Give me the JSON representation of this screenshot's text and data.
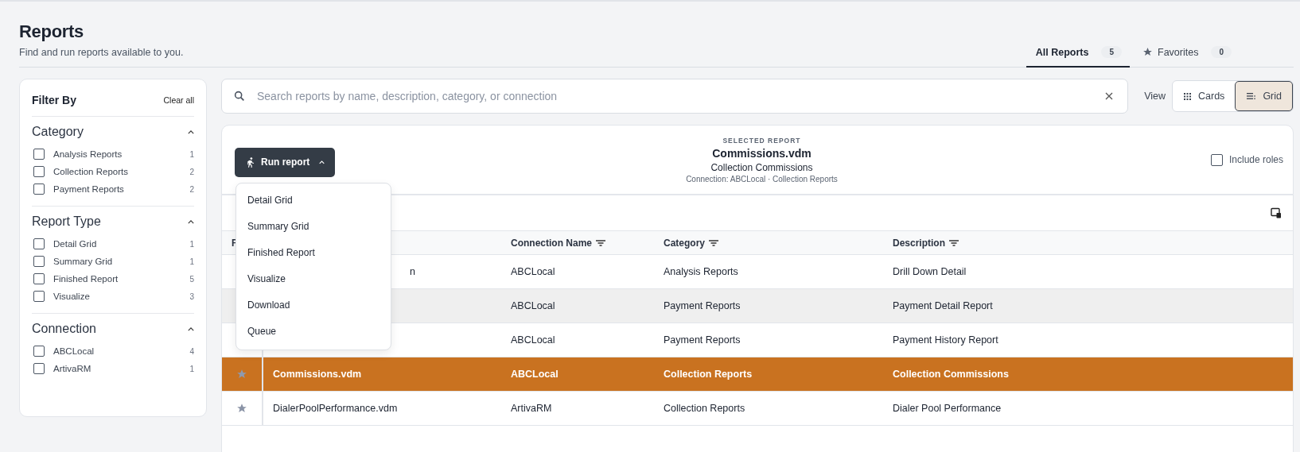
{
  "header": {
    "title": "Reports",
    "subtitle": "Find and run reports available to you."
  },
  "tabs": [
    {
      "label": "All Reports",
      "count": "5",
      "kind": "plain",
      "selected": true
    },
    {
      "label": "Favorites",
      "count": "0",
      "kind": "starred",
      "selected": false
    }
  ],
  "filter": {
    "title": "Filter By",
    "clear": "Clear all",
    "groups": [
      {
        "title": "Category",
        "expanded": true,
        "options": [
          {
            "label": "Analysis Reports",
            "count": "1",
            "checked": false
          },
          {
            "label": "Collection Reports",
            "count": "2",
            "checked": false
          },
          {
            "label": "Payment Reports",
            "count": "2",
            "checked": false
          }
        ]
      },
      {
        "title": "Report Type",
        "expanded": true,
        "options": [
          {
            "label": "Detail Grid",
            "count": "1",
            "checked": false
          },
          {
            "label": "Summary Grid",
            "count": "1",
            "checked": false
          },
          {
            "label": "Finished Report",
            "count": "5",
            "checked": false
          },
          {
            "label": "Visualize",
            "count": "3",
            "checked": false
          }
        ]
      },
      {
        "title": "Connection",
        "expanded": true,
        "options": [
          {
            "label": "ABCLocal",
            "count": "4",
            "checked": false
          },
          {
            "label": "ArtivaRM",
            "count": "1",
            "checked": false
          }
        ]
      }
    ]
  },
  "search": {
    "placeholder": "Search reports by name, description, category, or connection"
  },
  "view": {
    "label": "View",
    "options": [
      {
        "label": "Cards",
        "kind": "cards",
        "selected": false
      },
      {
        "label": "Grid",
        "kind": "grid",
        "selected": true
      }
    ]
  },
  "selected_report": {
    "eyebrow": "SELECTED REPORT",
    "name": "Commissions.vdm",
    "description": "Collection Commissions",
    "meta": "Connection: ABCLocal · Collection Reports"
  },
  "run_button": {
    "label": "Run report",
    "expanded": true
  },
  "run_menu": [
    "Detail Grid",
    "Summary Grid",
    "Finished Report",
    "Visualize",
    "Download",
    "Queue"
  ],
  "include_roles": {
    "label": "Include roles",
    "checked": false
  },
  "table": {
    "columns": [
      {
        "label": "F"
      },
      {
        "label": "Connection Name",
        "filterable": true
      },
      {
        "label": "Category",
        "filterable": true
      },
      {
        "label": "Description",
        "filterable": true
      }
    ],
    "rows": [
      {
        "name": "n",
        "name_cut": true,
        "connection": "ABCLocal",
        "category": "Analysis Reports",
        "description": "Drill Down Detail",
        "hovered": false,
        "selected": false
      },
      {
        "connection": "ABCLocal",
        "category": "Payment Reports",
        "description": "Payment Detail Report",
        "hovered": true,
        "selected": false
      },
      {
        "connection": "ABCLocal",
        "category": "Payment Reports",
        "description": "Payment History Report",
        "hovered": false,
        "selected": false
      },
      {
        "favorite": false,
        "name": "Commissions.vdm",
        "name_cut": false,
        "connection": "ABCLocal",
        "category": "Collection Reports",
        "description": "Collection Commissions",
        "hovered": false,
        "selected": true
      },
      {
        "favorite": false,
        "name": "DialerPoolPerformance.vdm",
        "name_cut": false,
        "connection": "ArtivaRM",
        "category": "Collection Reports",
        "description": "Dialer Pool Performance",
        "hovered": false,
        "selected": false
      }
    ]
  }
}
